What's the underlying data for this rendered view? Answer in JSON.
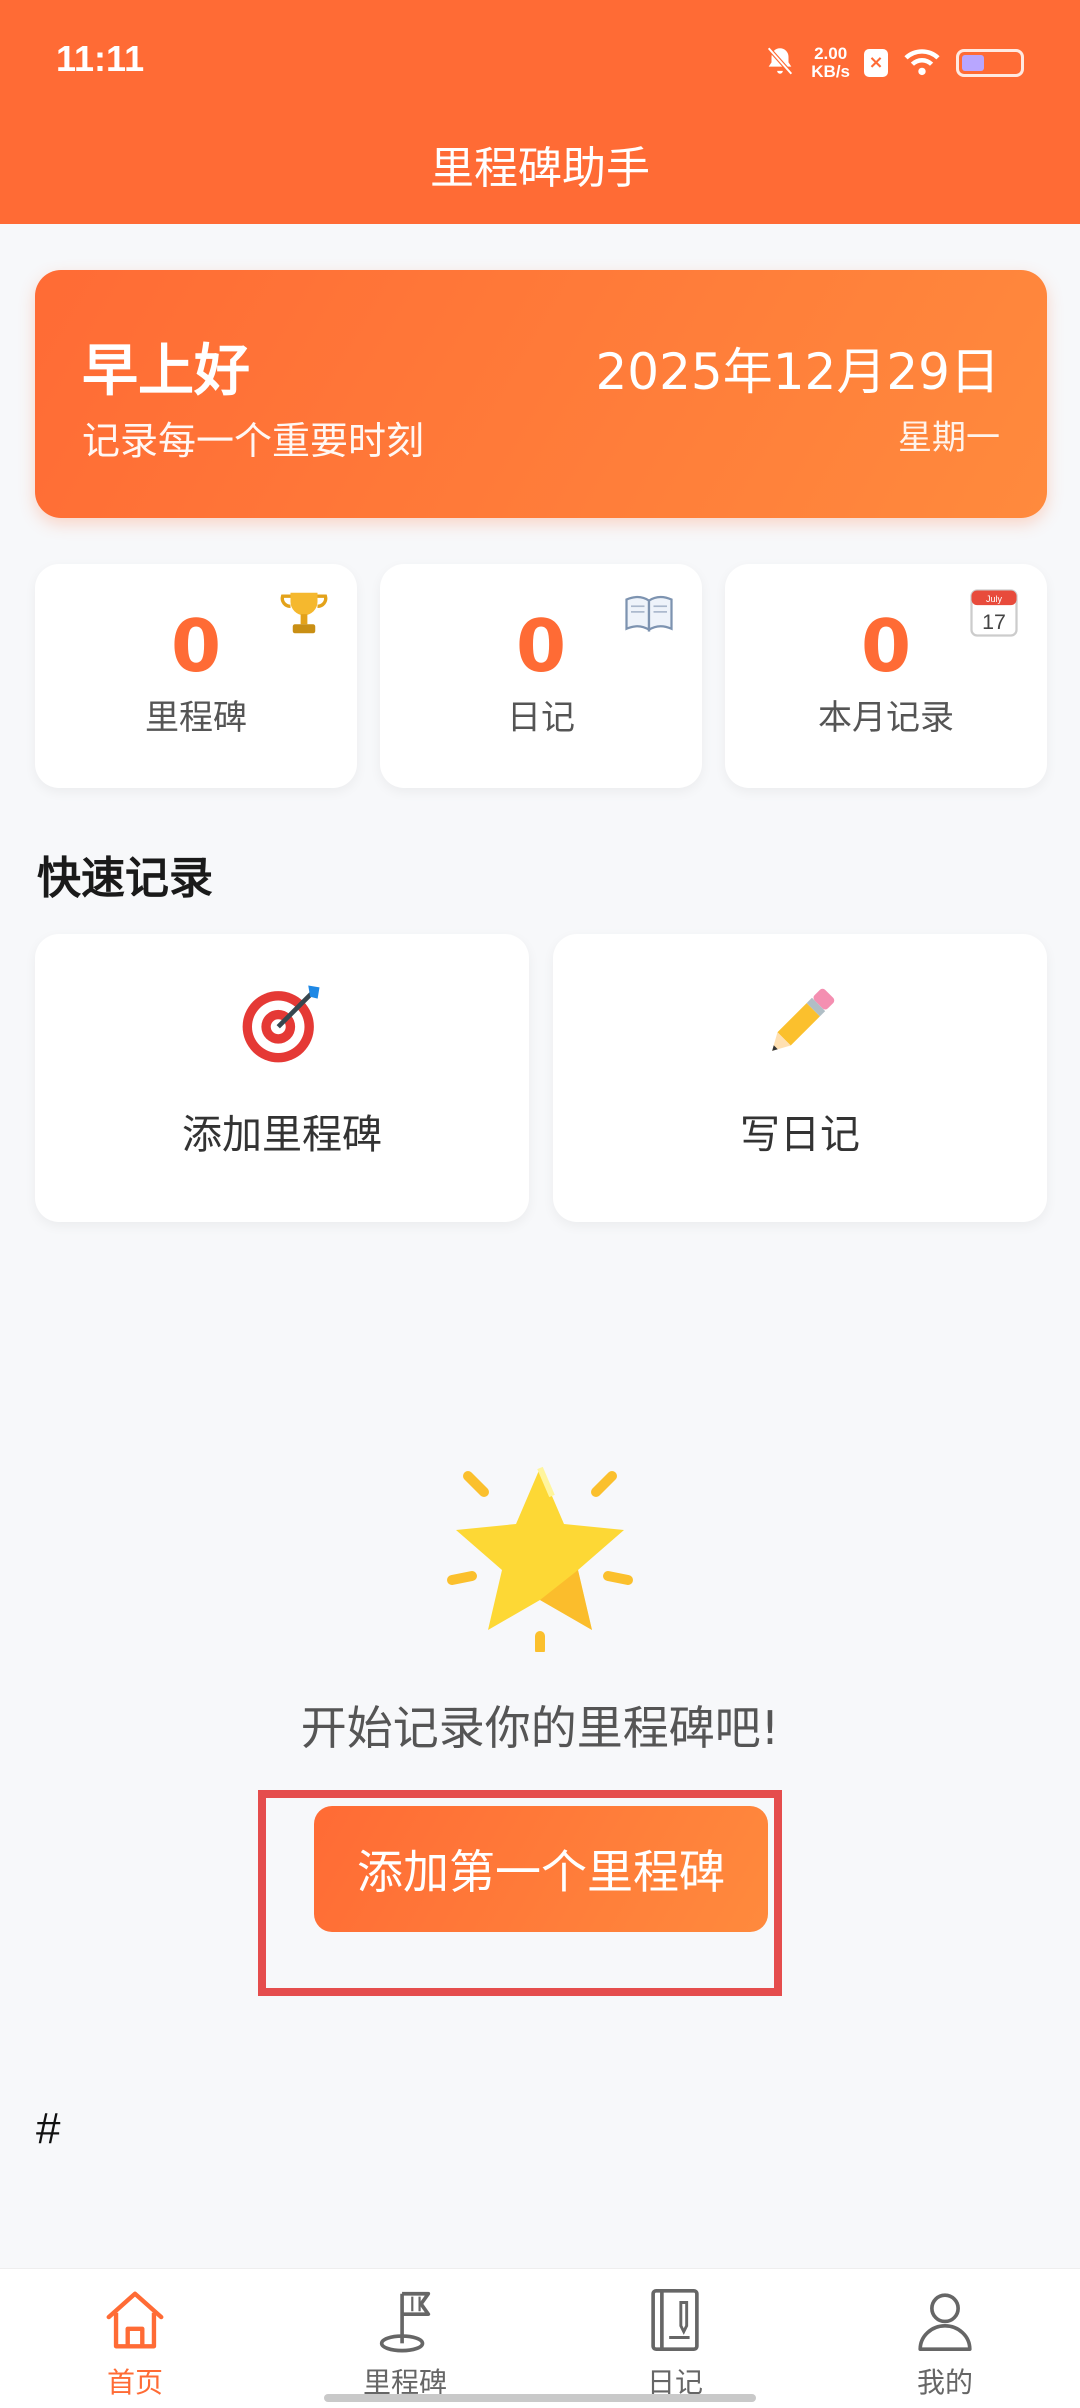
{
  "status_bar": {
    "time": "11:11",
    "net_speed_value": "2.00",
    "net_speed_unit": "KB/s",
    "icons": [
      "bell-off-icon",
      "sim-icon",
      "wifi-icon",
      "battery-icon"
    ]
  },
  "header": {
    "title": "里程碑助手"
  },
  "greeting": {
    "title": "早上好",
    "subtitle": "记录每一个重要时刻",
    "date": "2025年12月29日",
    "weekday": "星期一"
  },
  "stats": [
    {
      "value": "0",
      "label": "里程碑",
      "icon": "trophy-icon"
    },
    {
      "value": "0",
      "label": "日记",
      "icon": "book-icon"
    },
    {
      "value": "0",
      "label": "本月记录",
      "icon": "calendar-icon",
      "calendar_month": "July",
      "calendar_day": "17"
    }
  ],
  "quick": {
    "title": "快速记录",
    "items": [
      {
        "label": "添加里程碑",
        "icon": "target-icon"
      },
      {
        "label": "写日记",
        "icon": "pencil-icon"
      }
    ]
  },
  "empty_state": {
    "icon": "star-icon",
    "text": "开始记录你的里程碑吧!",
    "button_label": "添加第一个里程碑"
  },
  "footer_text": "#",
  "nav": {
    "items": [
      {
        "label": "首页",
        "icon": "home-icon",
        "active": true
      },
      {
        "label": "里程碑",
        "icon": "milestone-flag-icon",
        "active": false
      },
      {
        "label": "日记",
        "icon": "diary-icon",
        "active": false
      },
      {
        "label": "我的",
        "icon": "profile-icon",
        "active": false
      }
    ]
  },
  "colors": {
    "accent": "#ff6b35",
    "accent_light": "#ff8a3d",
    "highlight": "#e54d4d",
    "background": "#f7f8fa"
  }
}
